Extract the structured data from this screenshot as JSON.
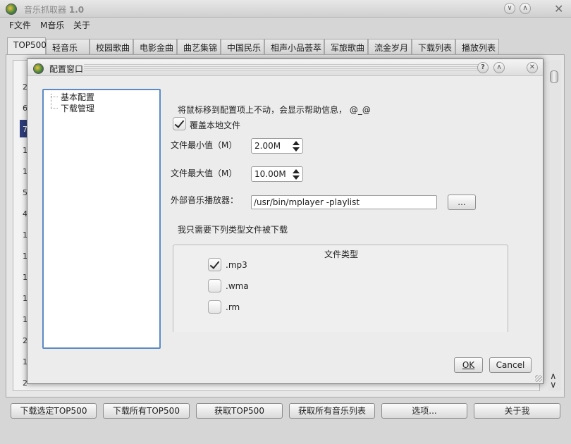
{
  "app": {
    "title": "音乐抓取器",
    "version": "1.0"
  },
  "menubar": [
    {
      "label": "F文件"
    },
    {
      "label": "M音乐"
    },
    {
      "label": "关于"
    }
  ],
  "tabs": [
    {
      "label": "TOP500",
      "active": true
    },
    {
      "label": "轻音乐"
    },
    {
      "label": "校园歌曲"
    },
    {
      "label": "电影金曲"
    },
    {
      "label": "曲艺集锦"
    },
    {
      "label": "中国民乐"
    },
    {
      "label": "相声小品荟萃"
    },
    {
      "label": "军旅歌曲"
    },
    {
      "label": "流金岁月"
    },
    {
      "label": "下载列表"
    },
    {
      "label": "播放列表"
    }
  ],
  "background_table": {
    "row_numbers": [
      "2",
      "6",
      "7",
      "1",
      "1",
      "5",
      "4",
      "1",
      "1",
      "1",
      "1",
      "1",
      "2",
      "1",
      "2"
    ]
  },
  "bottom_buttons": [
    {
      "label": "下载选定TOP500"
    },
    {
      "label": "下载所有TOP500"
    },
    {
      "label": "获取TOP500"
    },
    {
      "label": "获取所有音乐列表"
    },
    {
      "label": "选项..."
    },
    {
      "label": "关于我"
    }
  ],
  "dialog": {
    "title": "配置窗口",
    "tree": [
      {
        "label": "基本配置"
      },
      {
        "label": "下载管理"
      }
    ],
    "help_text": "将鼠标移到配置项上不动，会显示帮助信息， @_@",
    "overwrite_label": "覆盖本地文件",
    "overwrite_checked": true,
    "min_size": {
      "label": "文件最小值（M）",
      "value": "2.00M"
    },
    "max_size": {
      "label": "文件最大值（M）",
      "value": "10.00M"
    },
    "player": {
      "label": "外部音乐播放器：",
      "value": "/usr/bin/mplayer -playlist",
      "browse_label": "..."
    },
    "filetype_intro": "我只需要下列类型文件被下载",
    "filetype_group_title": "文件类型",
    "filetypes": [
      {
        "label": ".mp3",
        "checked": true
      },
      {
        "label": ".wma",
        "checked": false
      },
      {
        "label": ".rm",
        "checked": false
      }
    ],
    "ok_label": "OK",
    "cancel_label": "Cancel"
  }
}
